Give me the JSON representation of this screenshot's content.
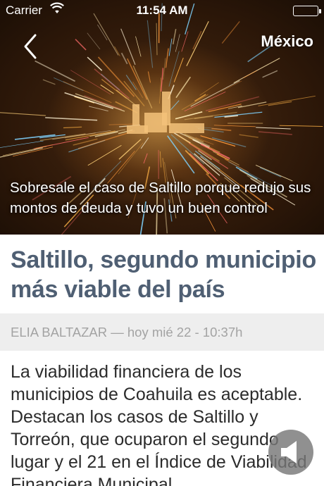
{
  "status_bar": {
    "carrier": "Carrier",
    "time": "11:54 AM",
    "wifi_icon": "wifi-icon",
    "battery_icon": "battery-icon"
  },
  "nav": {
    "back_icon": "chevron-left-icon",
    "section": "México"
  },
  "hero": {
    "image": "night city photo with light streaks",
    "caption": "Sobresale el caso de Saltillo porque redujo sus montos de deuda y tuvo un buen control"
  },
  "article": {
    "title": "Saltillo, segundo municipio más viable del país",
    "author": "ELIA BALTAZAR",
    "separator": "—",
    "date": "hoy mié 22 - 10:37h",
    "body": "La viabilidad financiera de los municipios de Coahuila es aceptable. Destacan los casos de Saltillo y Torreón, que ocuparon el segundo lugar y el 21 en el Índice de Viabilidad Financiera Municipal"
  },
  "audio_button": {
    "icon": "speaker-icon"
  },
  "colors": {
    "headline": "#4f5f73",
    "byline_bg": "#eeeeee",
    "byline_text": "#a3a3a3",
    "body_text": "#2b2b2b"
  }
}
